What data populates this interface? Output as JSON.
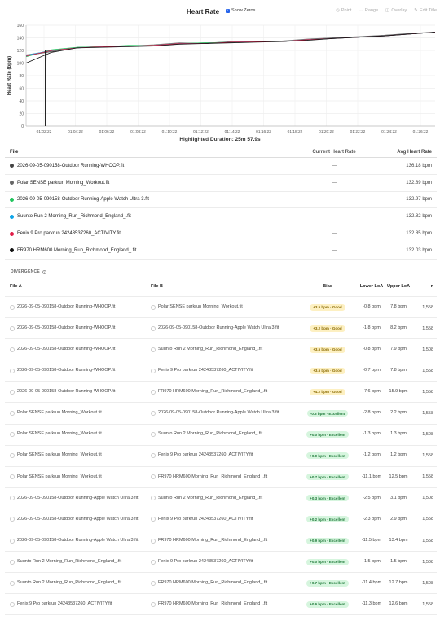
{
  "header": {
    "title": "Heart Rate",
    "show_zeros": "Show Zeros",
    "tools": {
      "point": "Point",
      "range": "Range",
      "overlay": "Overlay",
      "edit_title": "Edit Title"
    }
  },
  "chart_data": {
    "type": "line",
    "title": "Heart Rate",
    "xlabel": "",
    "ylabel": "Heart Rate (bpm)",
    "ylim": [
      0,
      160
    ],
    "yticks": [
      0,
      20,
      40,
      60,
      80,
      100,
      120,
      140,
      160
    ],
    "xticks": [
      "01:02:22",
      "01:04:22",
      "01:06:22",
      "01:08:22",
      "01:10:22",
      "01:12:22",
      "01:14:22",
      "01:16:22",
      "01:18:22",
      "01:20:22",
      "01:22:22",
      "01:24:22",
      "01:26:22"
    ],
    "grid": true,
    "series": [
      {
        "name": "2026-09-05-090158-Outdoor Running-WHOOP.fit",
        "color": "#555555",
        "points": [
          [
            0,
            112
          ],
          [
            1,
            118
          ],
          [
            2,
            125
          ],
          [
            3,
            126
          ],
          [
            4,
            127
          ],
          [
            5,
            128
          ],
          [
            6,
            131
          ],
          [
            7,
            132
          ],
          [
            8,
            133
          ],
          [
            9,
            135
          ],
          [
            10,
            134
          ],
          [
            11,
            137
          ],
          [
            12,
            140
          ],
          [
            13,
            141
          ],
          [
            14,
            144
          ],
          [
            15,
            147
          ],
          [
            16,
            149
          ]
        ]
      },
      {
        "name": "Polar SENSE parkrun Morning_Workout.fit",
        "color": "#777777",
        "points": [
          [
            0,
            113
          ],
          [
            1,
            119
          ],
          [
            2,
            124
          ],
          [
            3,
            127
          ],
          [
            4,
            127
          ],
          [
            5,
            129
          ],
          [
            6,
            132
          ],
          [
            7,
            131
          ],
          [
            8,
            134
          ],
          [
            9,
            135
          ],
          [
            10,
            135
          ],
          [
            11,
            138
          ],
          [
            12,
            140
          ],
          [
            13,
            142
          ],
          [
            14,
            144
          ],
          [
            15,
            146
          ],
          [
            16,
            149
          ]
        ]
      },
      {
        "name": "2026-09-05-090158-Outdoor Running-Apple Watch Ultra 3.fit",
        "color": "#22c55e",
        "points": [
          [
            0,
            110
          ],
          [
            1,
            121
          ],
          [
            2,
            125
          ],
          [
            3,
            126
          ],
          [
            4,
            128
          ],
          [
            5,
            128
          ],
          [
            6,
            131
          ],
          [
            7,
            132
          ],
          [
            8,
            133
          ],
          [
            9,
            134
          ],
          [
            10,
            134
          ],
          [
            11,
            137
          ],
          [
            12,
            139
          ],
          [
            13,
            141
          ],
          [
            14,
            143
          ],
          [
            15,
            146
          ],
          [
            16,
            149
          ]
        ]
      },
      {
        "name": "Suunto Run 2 Morning_Run_Richmond_England_.fit",
        "color": "#0ea5e9",
        "points": [
          [
            0,
            112
          ],
          [
            1,
            120
          ],
          [
            2,
            124
          ],
          [
            3,
            126
          ],
          [
            4,
            127
          ],
          [
            5,
            128
          ],
          [
            6,
            131
          ],
          [
            7,
            131
          ],
          [
            8,
            133
          ],
          [
            9,
            134
          ],
          [
            10,
            134
          ],
          [
            11,
            137
          ],
          [
            12,
            139
          ],
          [
            13,
            141
          ],
          [
            14,
            143
          ],
          [
            15,
            146
          ],
          [
            16,
            149
          ]
        ]
      },
      {
        "name": "Fenix 9 Pro parkrun 24243537260_ACTIVITY.fit",
        "color": "#e11d48",
        "points": [
          [
            0,
            111
          ],
          [
            1,
            120
          ],
          [
            2,
            124
          ],
          [
            3,
            126
          ],
          [
            4,
            127
          ],
          [
            5,
            128
          ],
          [
            6,
            131
          ],
          [
            7,
            131
          ],
          [
            8,
            133
          ],
          [
            9,
            134
          ],
          [
            10,
            134
          ],
          [
            11,
            137
          ],
          [
            12,
            139
          ],
          [
            13,
            141
          ],
          [
            14,
            143
          ],
          [
            15,
            146
          ],
          [
            16,
            149
          ]
        ]
      },
      {
        "name": "FR970 HRM600 Morning_Run_Richmond_England_.fit",
        "color": "#111111",
        "points": [
          [
            0,
            100
          ],
          [
            1,
            117
          ],
          [
            2,
            124
          ],
          [
            3,
            125
          ],
          [
            4,
            126
          ],
          [
            5,
            127
          ],
          [
            6,
            130
          ],
          [
            7,
            131
          ],
          [
            8,
            132
          ],
          [
            9,
            133
          ],
          [
            10,
            134
          ],
          [
            11,
            136
          ],
          [
            12,
            139
          ],
          [
            13,
            141
          ],
          [
            14,
            143
          ],
          [
            15,
            146
          ],
          [
            16,
            149
          ]
        ]
      }
    ]
  },
  "duration_label": "Highlighted Duration: 25m 57.9s",
  "files_table": {
    "headers": {
      "file": "File",
      "current": "Current Heart Rate",
      "avg": "Avg Heart Rate"
    },
    "rows": [
      {
        "name": "2026-09-05-090158-Outdoor Running-WHOOP.fit",
        "color": "#444444",
        "current": "—",
        "avg": "136.18 bpm"
      },
      {
        "name": "Polar SENSE parkrun Morning_Workout.fit",
        "color": "#666666",
        "current": "—",
        "avg": "132.89 bpm"
      },
      {
        "name": "2026-09-05-090158-Outdoor Running-Apple Watch Ultra 3.fit",
        "color": "#22c55e",
        "current": "—",
        "avg": "132.97 bpm"
      },
      {
        "name": "Suunto Run 2 Morning_Run_Richmond_England_.fit",
        "color": "#0ea5e9",
        "current": "—",
        "avg": "132.82 bpm"
      },
      {
        "name": "Fenix 9 Pro parkrun 24243537260_ACTIVITY.fit",
        "color": "#e11d48",
        "current": "—",
        "avg": "132.85 bpm"
      },
      {
        "name": "FR970 HRM600 Morning_Run_Richmond_England_.fit",
        "color": "#111111",
        "current": "—",
        "avg": "132.03 bpm"
      }
    ]
  },
  "divergence": {
    "label": "DIVERGENCE",
    "headers": {
      "a": "File A",
      "b": "File B",
      "bias": "Bias",
      "lower": "Lower LoA",
      "upper": "Upper LoA",
      "n": "n"
    },
    "rows": [
      {
        "a": "2026-09-05-090158-Outdoor Running-WHOOP.fit",
        "b": "Polar SENSE parkrun Morning_Workout.fit",
        "bias": "+3.5 bpm · Good",
        "grade": "good",
        "lower": "-0.8 bpm",
        "upper": "7.8 bpm",
        "n": "1,558"
      },
      {
        "a": "2026-09-05-090158-Outdoor Running-WHOOP.fit",
        "b": "2026-09-05-090158-Outdoor Running-Apple Watch Ultra 3.fit",
        "bias": "+3.2 bpm · Good",
        "grade": "good",
        "lower": "-1.8 bpm",
        "upper": "8.2 bpm",
        "n": "1,558"
      },
      {
        "a": "2026-09-05-090158-Outdoor Running-WHOOP.fit",
        "b": "Suunto Run 2 Morning_Run_Richmond_England_.fit",
        "bias": "+3.5 bpm · Good",
        "grade": "good",
        "lower": "-0.8 bpm",
        "upper": "7.9 bpm",
        "n": "1,508"
      },
      {
        "a": "2026-09-05-090158-Outdoor Running-WHOOP.fit",
        "b": "Fenix 9 Pro parkrun 24243537260_ACTIVITY.fit",
        "bias": "+3.5 bpm · Good",
        "grade": "good",
        "lower": "-0.7 bpm",
        "upper": "7.8 bpm",
        "n": "1,558"
      },
      {
        "a": "2026-09-05-090158-Outdoor Running-WHOOP.fit",
        "b": "FR970 HRM600 Morning_Run_Richmond_England_.fit",
        "bias": "+4.2 bpm · Good",
        "grade": "good",
        "lower": "-7.6 bpm",
        "upper": "15.9 bpm",
        "n": "1,558"
      },
      {
        "a": "Polar SENSE parkrun Morning_Workout.fit",
        "b": "2026-09-05-090158-Outdoor Running-Apple Watch Ultra 3.fit",
        "bias": "-0.3 bpm · Excellent",
        "grade": "exc",
        "lower": "-2.8 bpm",
        "upper": "2.2 bpm",
        "n": "1,558"
      },
      {
        "a": "Polar SENSE parkrun Morning_Workout.fit",
        "b": "Suunto Run 2 Morning_Run_Richmond_England_.fit",
        "bias": "+0.0 bpm · Excellent",
        "grade": "exc",
        "lower": "-1.3 bpm",
        "upper": "1.3 bpm",
        "n": "1,508"
      },
      {
        "a": "Polar SENSE parkrun Morning_Workout.fit",
        "b": "Fenix 9 Pro parkrun 24243537260_ACTIVITY.fit",
        "bias": "+0.0 bpm · Excellent",
        "grade": "exc",
        "lower": "-1.2 bpm",
        "upper": "1.2 bpm",
        "n": "1,558"
      },
      {
        "a": "Polar SENSE parkrun Morning_Workout.fit",
        "b": "FR970 HRM600 Morning_Run_Richmond_England_.fit",
        "bias": "+0.7 bpm · Excellent",
        "grade": "exc",
        "lower": "-11.1 bpm",
        "upper": "12.5 bpm",
        "n": "1,558"
      },
      {
        "a": "2026-09-05-090158-Outdoor Running-Apple Watch Ultra 3.fit",
        "b": "Suunto Run 2 Morning_Run_Richmond_England_.fit",
        "bias": "+0.3 bpm · Excellent",
        "grade": "exc",
        "lower": "-2.5 bpm",
        "upper": "3.1 bpm",
        "n": "1,508"
      },
      {
        "a": "2026-09-05-090158-Outdoor Running-Apple Watch Ultra 3.fit",
        "b": "Fenix 9 Pro parkrun 24243537260_ACTIVITY.fit",
        "bias": "+0.2 bpm · Excellent",
        "grade": "exc",
        "lower": "-2.3 bpm",
        "upper": "2.9 bpm",
        "n": "1,558"
      },
      {
        "a": "2026-09-05-090158-Outdoor Running-Apple Watch Ultra 3.fit",
        "b": "FR970 HRM600 Morning_Run_Richmond_England_.fit",
        "bias": "+0.9 bpm · Excellent",
        "grade": "exc",
        "lower": "-11.5 bpm",
        "upper": "13.4 bpm",
        "n": "1,558"
      },
      {
        "a": "Suunto Run 2 Morning_Run_Richmond_England_.fit",
        "b": "Fenix 9 Pro parkrun 24243537260_ACTIVITY.fit",
        "bias": "+0.0 bpm · Excellent",
        "grade": "exc",
        "lower": "-1.5 bpm",
        "upper": "1.5 bpm",
        "n": "1,508"
      },
      {
        "a": "Suunto Run 2 Morning_Run_Richmond_England_.fit",
        "b": "FR970 HRM600 Morning_Run_Richmond_England_.fit",
        "bias": "+0.7 bpm · Excellent",
        "grade": "exc",
        "lower": "-11.4 bpm",
        "upper": "12.7 bpm",
        "n": "1,508"
      },
      {
        "a": "Fenix 9 Pro parkrun 24243537260_ACTIVITY.fit",
        "b": "FR970 HRM600 Morning_Run_Richmond_England_.fit",
        "bias": "+0.6 bpm · Excellent",
        "grade": "exc",
        "lower": "-11.3 bpm",
        "upper": "12.6 bpm",
        "n": "1,558"
      }
    ]
  }
}
